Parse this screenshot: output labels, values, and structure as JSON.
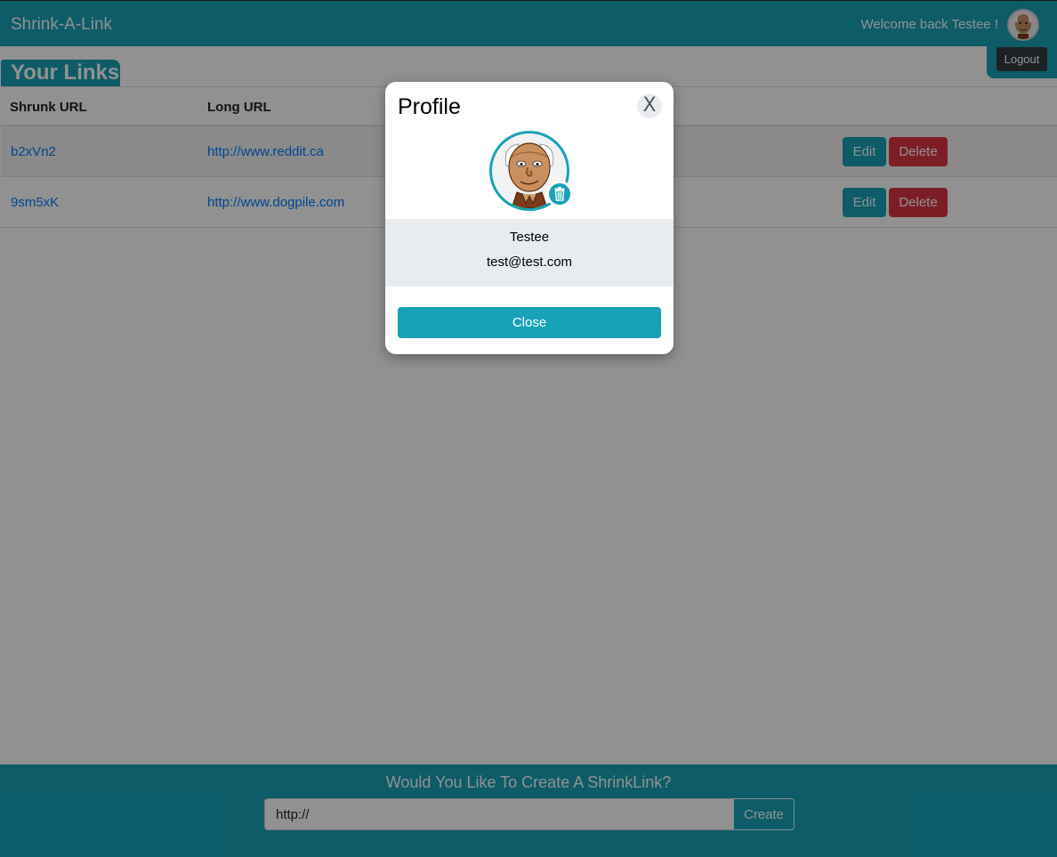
{
  "navbar": {
    "brand": "Shrink-A-Link",
    "welcome": "Welcome back Testee !",
    "avatar_icon": "avatar-icon",
    "logout_label": "Logout"
  },
  "page": {
    "title": "Your Links"
  },
  "table": {
    "headers": [
      "Shrunk URL",
      "Long URL"
    ],
    "rows": [
      {
        "short": "b2xVn2",
        "long": "http://www.reddit.ca",
        "edit": "Edit",
        "delete": "Delete"
      },
      {
        "short": "9sm5xK",
        "long": "http://www.dogpile.com",
        "edit": "Edit",
        "delete": "Delete"
      }
    ]
  },
  "footer": {
    "prompt": "Would You Like To Create A ShrinkLink?",
    "input_value": "http://",
    "create_label": "Create"
  },
  "modal": {
    "title": "Profile",
    "close_x": "X",
    "name": "Testee",
    "email": "test@test.com",
    "close_label": "Close",
    "avatar_icon": "avatar-icon",
    "badge_icon": "trash-icon"
  },
  "colors": {
    "primary": "#17a2b8",
    "danger": "#dc3545",
    "dark": "#343a40",
    "link": "#007bff"
  }
}
